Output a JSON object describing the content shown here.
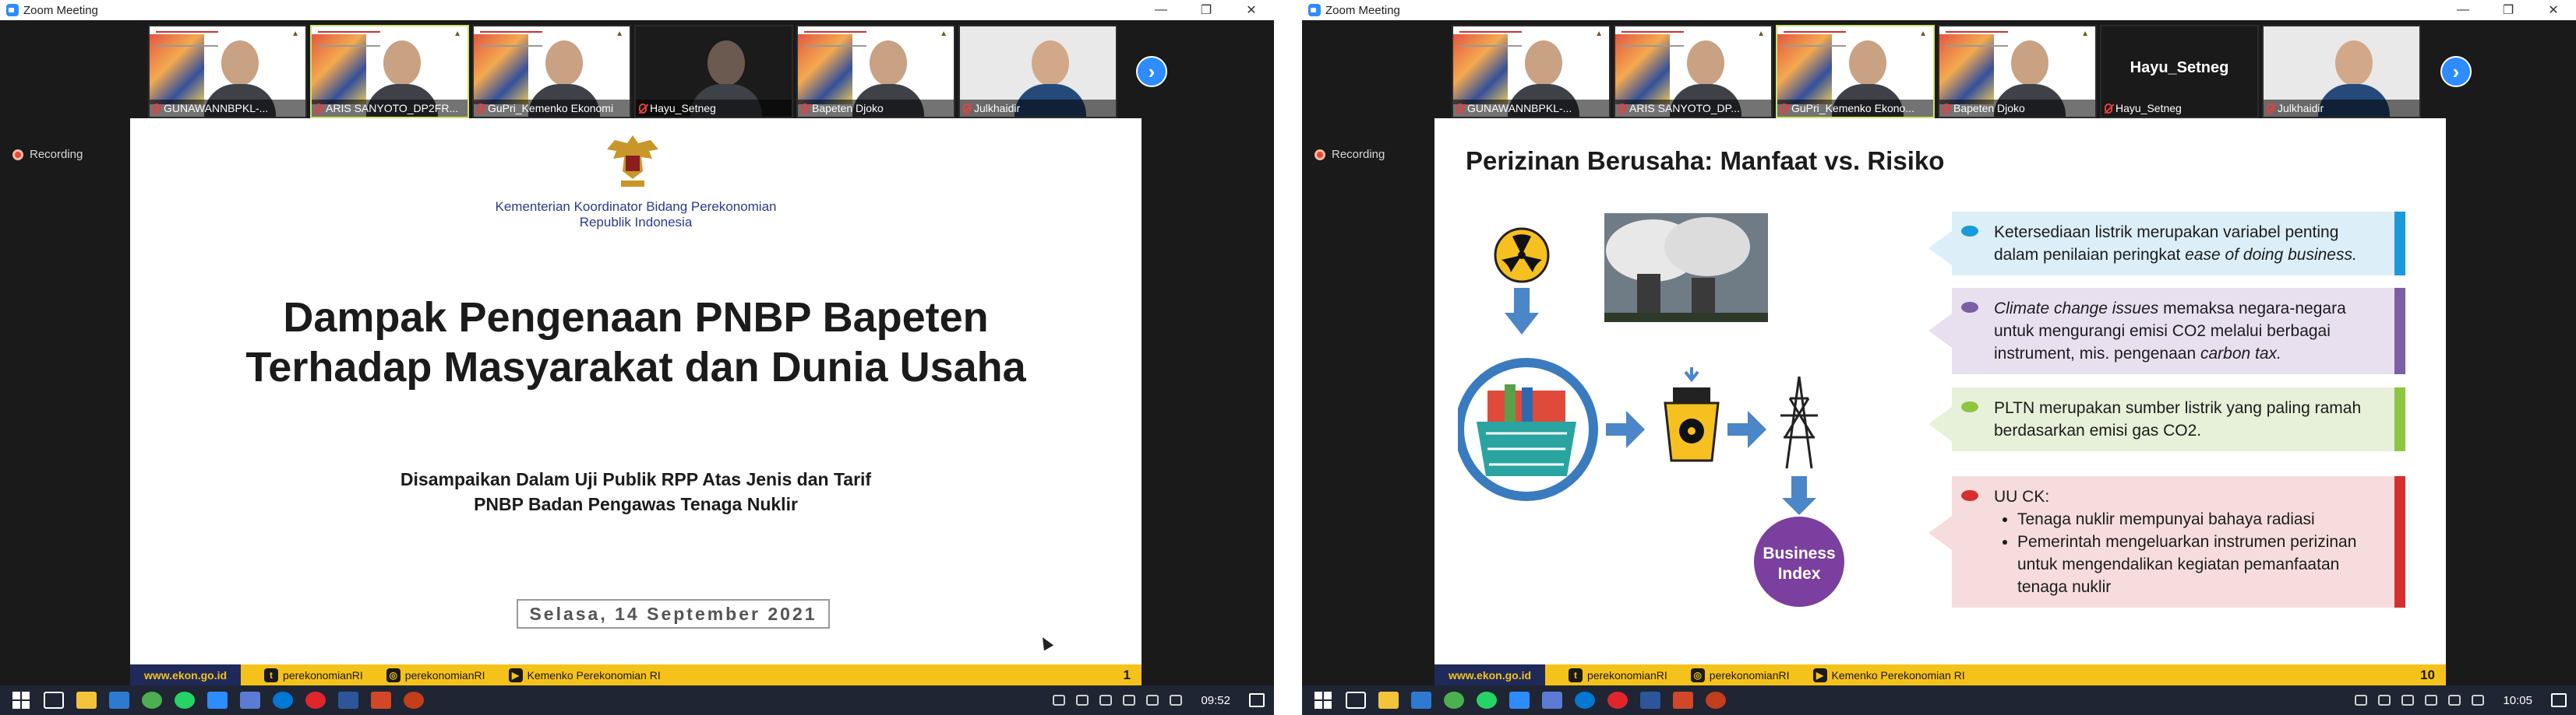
{
  "left": {
    "window_title": "Zoom Meeting",
    "recording_label": "Recording",
    "participants": [
      {
        "name": "GUNAWANNBPKL-..."
      },
      {
        "name": "ARIS SANYOTO_DP2FR..."
      },
      {
        "name": "GuPri_Kemenko Ekonomi"
      },
      {
        "name": "Hayu_Setneg"
      },
      {
        "name": "Bapeten Djoko"
      },
      {
        "name": "Julkhaidir"
      }
    ],
    "slide": {
      "ministry_line1": "Kementerian Koordinator Bidang Perekonomian",
      "ministry_line2": "Republik Indonesia",
      "title_line1": "Dampak Pengenaan PNBP Bapeten",
      "title_line2": "Terhadap Masyarakat dan Dunia Usaha",
      "subtitle_line1": "Disampaikan Dalam Uji Publik RPP Atas Jenis dan Tarif",
      "subtitle_line2": "PNBP Badan Pengawas Tenaga Nuklir",
      "date": "Selasa, 14 September 2021",
      "page_number": "1"
    },
    "clock": "09:52"
  },
  "right": {
    "window_title": "Zoom Meeting",
    "recording_label": "Recording",
    "participants": [
      {
        "name": "GUNAWANNBPKL-..."
      },
      {
        "name": "ARIS SANYOTO_DP..."
      },
      {
        "name": "GuPri_Kemenko Ekono..."
      },
      {
        "name": "Bapeten Djoko"
      },
      {
        "name": "Hayu_Setneg",
        "blank_label": "Hayu_Setneg"
      },
      {
        "name": "Julkhaidir"
      }
    ],
    "slide": {
      "title": "Perizinan Berusaha: Manfaat vs. Risiko",
      "business_index_line1": "Business",
      "business_index_line2": "Index",
      "c1_text_a": "Ketersediaan listrik merupakan variabel penting dalam penilaian peringkat ",
      "c1_text_b": "ease of doing business.",
      "c2_text_a": "Climate change issues",
      "c2_text_b": " memaksa negara-negara untuk mengurangi emisi CO2 melalui berbagai instrument, mis. pengenaan ",
      "c2_text_c": "carbon tax.",
      "c3_text": "PLTN merupakan sumber listrik yang paling ramah berdasarkan emisi gas CO2.",
      "c4_heading": "UU CK:",
      "c4_items": [
        "Tenaga nuklir mempunyai bahaya radiasi",
        "Pemerintah mengeluarkan instrumen perizinan untuk mengendalikan kegiatan pemanfaatan tenaga nuklir"
      ],
      "page_number": "10"
    },
    "clock": "10:05"
  },
  "footer": {
    "site": "www.ekon.go.id",
    "twitter": "perekonomianRI",
    "instagram": "perekonomianRI",
    "youtube": "Kemenko Perekonomian RI"
  },
  "window_buttons": {
    "minimize": "—",
    "maximize": "❐",
    "close": "✕"
  },
  "colors": {
    "zoom_blue": "#2d8cff",
    "footer_yellow": "#f5c21b",
    "navy": "#1f2a5a"
  }
}
